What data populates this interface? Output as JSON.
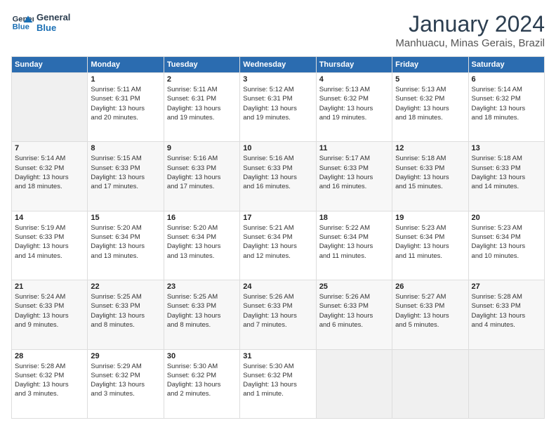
{
  "logo": {
    "text_general": "General",
    "text_blue": "Blue"
  },
  "title": "January 2024",
  "subtitle": "Manhuacu, Minas Gerais, Brazil",
  "days_of_week": [
    "Sunday",
    "Monday",
    "Tuesday",
    "Wednesday",
    "Thursday",
    "Friday",
    "Saturday"
  ],
  "weeks": [
    [
      {
        "day": "",
        "info": ""
      },
      {
        "day": "1",
        "info": "Sunrise: 5:11 AM\nSunset: 6:31 PM\nDaylight: 13 hours\nand 20 minutes."
      },
      {
        "day": "2",
        "info": "Sunrise: 5:11 AM\nSunset: 6:31 PM\nDaylight: 13 hours\nand 19 minutes."
      },
      {
        "day": "3",
        "info": "Sunrise: 5:12 AM\nSunset: 6:31 PM\nDaylight: 13 hours\nand 19 minutes."
      },
      {
        "day": "4",
        "info": "Sunrise: 5:13 AM\nSunset: 6:32 PM\nDaylight: 13 hours\nand 19 minutes."
      },
      {
        "day": "5",
        "info": "Sunrise: 5:13 AM\nSunset: 6:32 PM\nDaylight: 13 hours\nand 18 minutes."
      },
      {
        "day": "6",
        "info": "Sunrise: 5:14 AM\nSunset: 6:32 PM\nDaylight: 13 hours\nand 18 minutes."
      }
    ],
    [
      {
        "day": "7",
        "info": "Sunrise: 5:14 AM\nSunset: 6:32 PM\nDaylight: 13 hours\nand 18 minutes."
      },
      {
        "day": "8",
        "info": "Sunrise: 5:15 AM\nSunset: 6:33 PM\nDaylight: 13 hours\nand 17 minutes."
      },
      {
        "day": "9",
        "info": "Sunrise: 5:16 AM\nSunset: 6:33 PM\nDaylight: 13 hours\nand 17 minutes."
      },
      {
        "day": "10",
        "info": "Sunrise: 5:16 AM\nSunset: 6:33 PM\nDaylight: 13 hours\nand 16 minutes."
      },
      {
        "day": "11",
        "info": "Sunrise: 5:17 AM\nSunset: 6:33 PM\nDaylight: 13 hours\nand 16 minutes."
      },
      {
        "day": "12",
        "info": "Sunrise: 5:18 AM\nSunset: 6:33 PM\nDaylight: 13 hours\nand 15 minutes."
      },
      {
        "day": "13",
        "info": "Sunrise: 5:18 AM\nSunset: 6:33 PM\nDaylight: 13 hours\nand 14 minutes."
      }
    ],
    [
      {
        "day": "14",
        "info": "Sunrise: 5:19 AM\nSunset: 6:33 PM\nDaylight: 13 hours\nand 14 minutes."
      },
      {
        "day": "15",
        "info": "Sunrise: 5:20 AM\nSunset: 6:34 PM\nDaylight: 13 hours\nand 13 minutes."
      },
      {
        "day": "16",
        "info": "Sunrise: 5:20 AM\nSunset: 6:34 PM\nDaylight: 13 hours\nand 13 minutes."
      },
      {
        "day": "17",
        "info": "Sunrise: 5:21 AM\nSunset: 6:34 PM\nDaylight: 13 hours\nand 12 minutes."
      },
      {
        "day": "18",
        "info": "Sunrise: 5:22 AM\nSunset: 6:34 PM\nDaylight: 13 hours\nand 11 minutes."
      },
      {
        "day": "19",
        "info": "Sunrise: 5:23 AM\nSunset: 6:34 PM\nDaylight: 13 hours\nand 11 minutes."
      },
      {
        "day": "20",
        "info": "Sunrise: 5:23 AM\nSunset: 6:34 PM\nDaylight: 13 hours\nand 10 minutes."
      }
    ],
    [
      {
        "day": "21",
        "info": "Sunrise: 5:24 AM\nSunset: 6:33 PM\nDaylight: 13 hours\nand 9 minutes."
      },
      {
        "day": "22",
        "info": "Sunrise: 5:25 AM\nSunset: 6:33 PM\nDaylight: 13 hours\nand 8 minutes."
      },
      {
        "day": "23",
        "info": "Sunrise: 5:25 AM\nSunset: 6:33 PM\nDaylight: 13 hours\nand 8 minutes."
      },
      {
        "day": "24",
        "info": "Sunrise: 5:26 AM\nSunset: 6:33 PM\nDaylight: 13 hours\nand 7 minutes."
      },
      {
        "day": "25",
        "info": "Sunrise: 5:26 AM\nSunset: 6:33 PM\nDaylight: 13 hours\nand 6 minutes."
      },
      {
        "day": "26",
        "info": "Sunrise: 5:27 AM\nSunset: 6:33 PM\nDaylight: 13 hours\nand 5 minutes."
      },
      {
        "day": "27",
        "info": "Sunrise: 5:28 AM\nSunset: 6:33 PM\nDaylight: 13 hours\nand 4 minutes."
      }
    ],
    [
      {
        "day": "28",
        "info": "Sunrise: 5:28 AM\nSunset: 6:32 PM\nDaylight: 13 hours\nand 3 minutes."
      },
      {
        "day": "29",
        "info": "Sunrise: 5:29 AM\nSunset: 6:32 PM\nDaylight: 13 hours\nand 3 minutes."
      },
      {
        "day": "30",
        "info": "Sunrise: 5:30 AM\nSunset: 6:32 PM\nDaylight: 13 hours\nand 2 minutes."
      },
      {
        "day": "31",
        "info": "Sunrise: 5:30 AM\nSunset: 6:32 PM\nDaylight: 13 hours\nand 1 minute."
      },
      {
        "day": "",
        "info": ""
      },
      {
        "day": "",
        "info": ""
      },
      {
        "day": "",
        "info": ""
      }
    ]
  ]
}
